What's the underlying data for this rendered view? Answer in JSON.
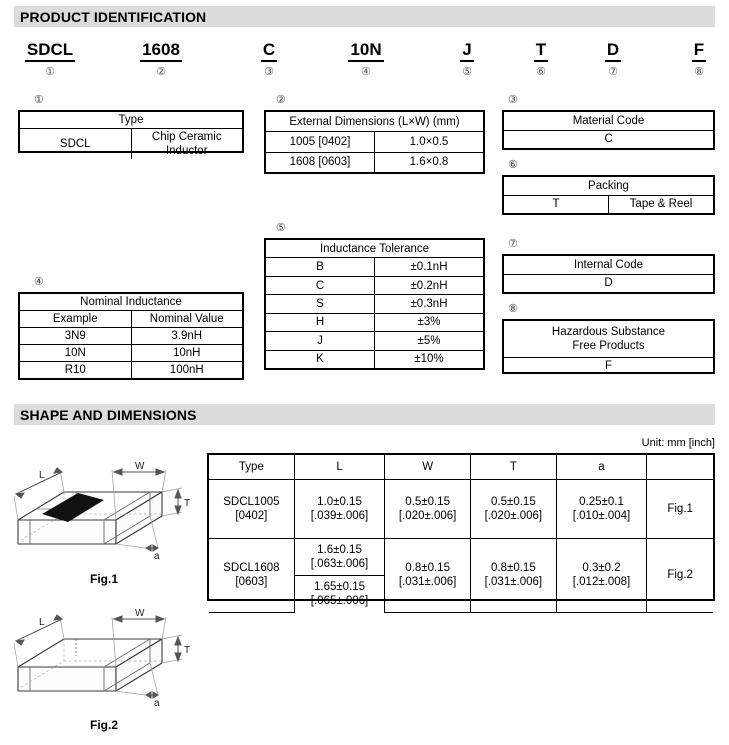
{
  "sections": {
    "product_identification": {
      "title": "PRODUCT IDENTIFICATION"
    },
    "shape_and_dimensions": {
      "title": "SHAPE AND DIMENSIONS",
      "unit_note": "Unit: mm [inch]"
    }
  },
  "part_number": {
    "segments": [
      {
        "code": "SDCL",
        "index": "①"
      },
      {
        "code": "1608",
        "index": "②"
      },
      {
        "code": "C",
        "index": "③"
      },
      {
        "code": "10N",
        "index": "④"
      },
      {
        "code": "J",
        "index": "⑤"
      },
      {
        "code": "T",
        "index": "⑥"
      },
      {
        "code": "D",
        "index": "⑦"
      },
      {
        "code": "F",
        "index": "⑧"
      }
    ]
  },
  "tables": {
    "type": {
      "index": "①",
      "header": "Type",
      "rows": [
        {
          "code": "SDCL",
          "value": "Chip Ceramic Inductor"
        }
      ]
    },
    "external_dimensions": {
      "index": "②",
      "header": "External Dimensions (L×W) (mm)",
      "rows": [
        {
          "code": "1005 [0402]",
          "value": "1.0×0.5"
        },
        {
          "code": "1608 [0603]",
          "value": "1.6×0.8"
        }
      ]
    },
    "material_code": {
      "index": "③",
      "header": "Material Code",
      "value": "C"
    },
    "nominal_inductance": {
      "index": "④",
      "header": "Nominal Inductance",
      "col_headers": [
        "Example",
        "Nominal Value"
      ],
      "rows": [
        {
          "code": "3N9",
          "value": "3.9nH"
        },
        {
          "code": "10N",
          "value": "10nH"
        },
        {
          "code": "R10",
          "value": "100nH"
        }
      ]
    },
    "inductance_tolerance": {
      "index": "⑤",
      "header": "Inductance Tolerance",
      "rows": [
        {
          "code": "B",
          "value": "±0.1nH"
        },
        {
          "code": "C",
          "value": "±0.2nH"
        },
        {
          "code": "S",
          "value": "±0.3nH"
        },
        {
          "code": "H",
          "value": "±3%"
        },
        {
          "code": "J",
          "value": "±5%"
        },
        {
          "code": "K",
          "value": "±10%"
        }
      ]
    },
    "packing": {
      "index": "⑥",
      "header": "Packing",
      "rows": [
        {
          "code": "T",
          "value": "Tape & Reel"
        }
      ]
    },
    "internal_code": {
      "index": "⑦",
      "header": "Internal Code",
      "value": "D"
    },
    "hazardous_substance": {
      "index": "⑧",
      "header_line1": "Hazardous Substance",
      "header_line2": "Free Products",
      "value": "F"
    },
    "dimensions": {
      "columns": [
        "Type",
        "L",
        "W",
        "T",
        "a",
        ""
      ],
      "rows": [
        {
          "type_line1": "SDCL1005",
          "type_line2": "[0402]",
          "L": [
            "1.0±0.15",
            "[.039±.006]"
          ],
          "W": [
            "0.5±0.15",
            "[.020±.006]"
          ],
          "T": [
            "0.5±0.15",
            "[.020±.006]"
          ],
          "a": [
            "0.25±0.1",
            "[.010±.004]"
          ],
          "fig": "Fig.1"
        },
        {
          "type_line1": "SDCL1608",
          "type_line2": "[0603]",
          "L_top": [
            "1.6±0.15",
            "[.063±.006]"
          ],
          "L_bottom": [
            "1.65±0.15",
            "[.065±.006]"
          ],
          "W": [
            "0.8±0.15",
            "[.031±.006]"
          ],
          "T": [
            "0.8±0.15",
            "[.031±.006]"
          ],
          "a": [
            "0.3±0.2",
            "[.012±.008]"
          ],
          "fig": "Fig.2"
        }
      ]
    }
  },
  "figures": {
    "fig1": {
      "caption": "Fig.1",
      "labels": {
        "L": "L",
        "W": "W",
        "T": "T",
        "a": "a"
      },
      "has_marking": true
    },
    "fig2": {
      "caption": "Fig.2",
      "labels": {
        "L": "L",
        "W": "W",
        "T": "T",
        "a": "a"
      },
      "has_marking": false
    }
  },
  "colors": {
    "section_bar": "#dcdcdc",
    "marking": "#000000",
    "line": "#000000"
  }
}
